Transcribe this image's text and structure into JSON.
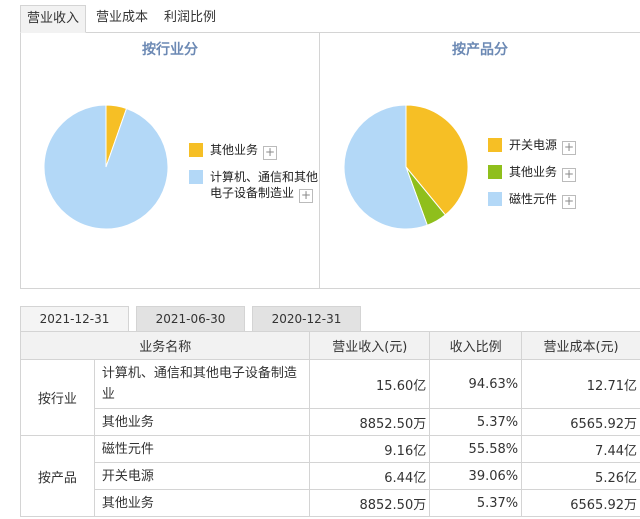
{
  "top_tabs": [
    "营业收入",
    "营业成本",
    "利润比例"
  ],
  "charts": {
    "industry": {
      "title": "按行业分",
      "legend": [
        "其他业务",
        "计算机、通信和其他电子设备制造业"
      ]
    },
    "product": {
      "title": "按产品分",
      "legend": [
        "开关电源",
        "其他业务",
        "磁性元件"
      ]
    }
  },
  "colors": {
    "yellow": "#f6bf25",
    "green": "#8fbf1c",
    "blue": "#b3d8f7"
  },
  "chart_data": [
    {
      "type": "pie",
      "title": "按行业分",
      "labels": [
        "其他业务",
        "计算机、通信和其他电子设备制造业"
      ],
      "values": [
        5.37,
        94.63
      ],
      "colors": [
        "#f6bf25",
        "#b3d8f7"
      ]
    },
    {
      "type": "pie",
      "title": "按产品分",
      "labels": [
        "开关电源",
        "其他业务",
        "磁性元件"
      ],
      "values": [
        39.06,
        5.37,
        55.58
      ],
      "colors": [
        "#f6bf25",
        "#8fbf1c",
        "#b3d8f7"
      ]
    }
  ],
  "date_tabs": [
    "2021-12-31",
    "2021-06-30",
    "2020-12-31"
  ],
  "table": {
    "headers": [
      "业务名称",
      "营业收入(元)",
      "收入比例",
      "营业成本(元)"
    ],
    "groups": [
      {
        "label": "按行业",
        "rows": [
          {
            "name": "计算机、通信和其他电子设备制造业",
            "revenue": "15.60亿",
            "ratio": "94.63%",
            "cost": "12.71亿"
          },
          {
            "name": "其他业务",
            "revenue": "8852.50万",
            "ratio": "5.37%",
            "cost": "6565.92万"
          }
        ]
      },
      {
        "label": "按产品",
        "rows": [
          {
            "name": "磁性元件",
            "revenue": "9.16亿",
            "ratio": "55.58%",
            "cost": "7.44亿"
          },
          {
            "name": "开关电源",
            "revenue": "6.44亿",
            "ratio": "39.06%",
            "cost": "5.26亿"
          },
          {
            "name": "其他业务",
            "revenue": "8852.50万",
            "ratio": "5.37%",
            "cost": "6565.92万"
          }
        ]
      }
    ]
  }
}
